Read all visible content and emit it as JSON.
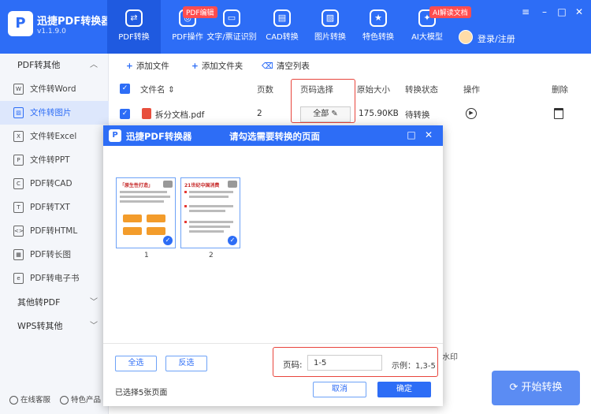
{
  "app": {
    "name": "迅捷PDF转换器",
    "version": "v1.1.9.0"
  },
  "nav": [
    {
      "label": "PDF转换",
      "icon": "convert-icon",
      "active": true
    },
    {
      "label": "PDF操作",
      "icon": "pdf-ops-icon",
      "badge": "PDF编辑"
    },
    {
      "label": "文字/票证识别",
      "icon": "ocr-icon"
    },
    {
      "label": "CAD转换",
      "icon": "cad-icon"
    },
    {
      "label": "图片转换",
      "icon": "image-icon"
    },
    {
      "label": "特色转换",
      "icon": "special-icon"
    },
    {
      "label": "AI大模型",
      "icon": "ai-icon",
      "badge": "AI解读文档"
    }
  ],
  "user": {
    "label": "登录/注册"
  },
  "sidebar": {
    "group1": "PDF转其他",
    "items": [
      {
        "label": "文件转Word",
        "icon": "word-icon"
      },
      {
        "label": "文件转图片",
        "icon": "image-icon",
        "active": true
      },
      {
        "label": "文件转Excel",
        "icon": "excel-icon"
      },
      {
        "label": "文件转PPT",
        "icon": "ppt-icon"
      },
      {
        "label": "PDF转CAD",
        "icon": "cad-icon"
      },
      {
        "label": "PDF转TXT",
        "icon": "txt-icon"
      },
      {
        "label": "PDF转HTML",
        "icon": "html-icon"
      },
      {
        "label": "PDF转长图",
        "icon": "long-image-icon"
      },
      {
        "label": "PDF转电子书",
        "icon": "ebook-icon"
      }
    ],
    "group2": "其他转PDF",
    "group3": "WPS转其他",
    "footer": {
      "support": "在线客服",
      "featured": "特色产品"
    }
  },
  "toolbar": {
    "add_file": "添加文件",
    "add_folder": "添加文件夹",
    "clear_list": "清空列表"
  },
  "table": {
    "headers": {
      "filename": "文件名",
      "pages": "页数",
      "page_select": "页码选择",
      "size": "原始大小",
      "status": "转换状态",
      "action": "操作",
      "delete": "删除"
    },
    "row": {
      "filename": "拆分文档.pdf",
      "pages": "2",
      "page_select": "全部",
      "size": "175.90KB",
      "status": "待转换"
    }
  },
  "watermark_text": "水印",
  "start_button": "开始转换",
  "dialog": {
    "app_name": "迅捷PDF转换器",
    "title": "请勾选需要转换的页面",
    "pages": [
      {
        "number": "1",
        "heading": "「原生性打造」"
      },
      {
        "number": "2",
        "heading": "21世纪中国消费"
      }
    ],
    "select_all": "全选",
    "invert": "反选",
    "range_label": "页码:",
    "range_value": "1-5",
    "example": "示例：1,3-5",
    "selected_text": "已选择5张页面",
    "cancel": "取消",
    "confirm": "确定"
  }
}
